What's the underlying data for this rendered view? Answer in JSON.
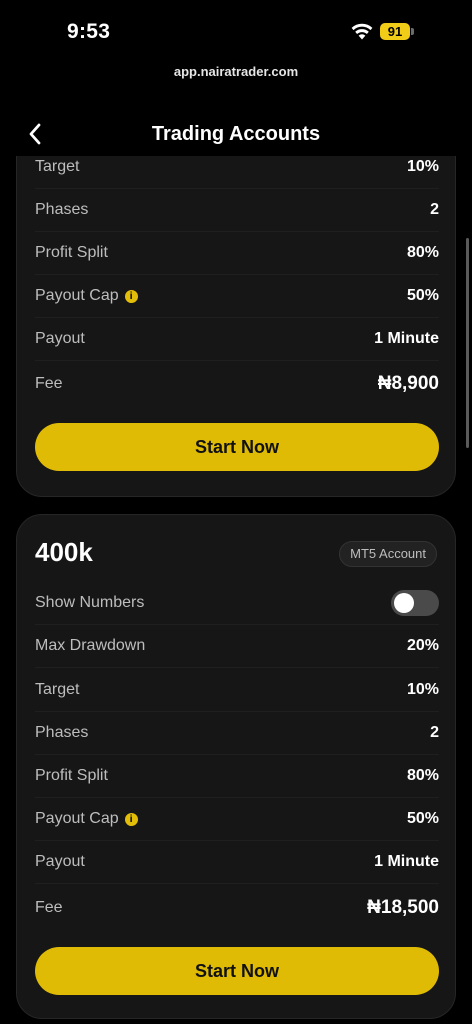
{
  "status_bar": {
    "time": "9:53",
    "battery": "91"
  },
  "browser": {
    "url": "app.nairatrader.com"
  },
  "header": {
    "title": "Trading Accounts"
  },
  "card_top": {
    "rows": [
      {
        "label": "Target",
        "value": "10%"
      },
      {
        "label": "Phases",
        "value": "2"
      },
      {
        "label": "Profit Split",
        "value": "80%"
      },
      {
        "label": "Payout Cap",
        "value": "50%"
      },
      {
        "label": "Payout",
        "value": "1 Minute"
      },
      {
        "label": "Fee",
        "value": "₦8,900"
      }
    ],
    "button": "Start Now"
  },
  "card_400k": {
    "title": "400k",
    "badge": "MT5 Account",
    "toggle_label": "Show Numbers",
    "toggle_on": false,
    "rows": [
      {
        "label": "Max Drawdown",
        "value": "20%"
      },
      {
        "label": "Target",
        "value": "10%"
      },
      {
        "label": "Phases",
        "value": "2"
      },
      {
        "label": "Profit Split",
        "value": "80%"
      },
      {
        "label": "Payout Cap",
        "value": "50%"
      },
      {
        "label": "Payout",
        "value": "1 Minute"
      },
      {
        "label": "Fee",
        "value": "₦18,500"
      }
    ],
    "button": "Start Now"
  },
  "colors": {
    "accent": "#dfbb05",
    "card": "#161616",
    "background": "#000000"
  },
  "icons": {
    "back": "chevron-left-icon",
    "info": "info-icon",
    "wifi": "wifi-icon"
  }
}
